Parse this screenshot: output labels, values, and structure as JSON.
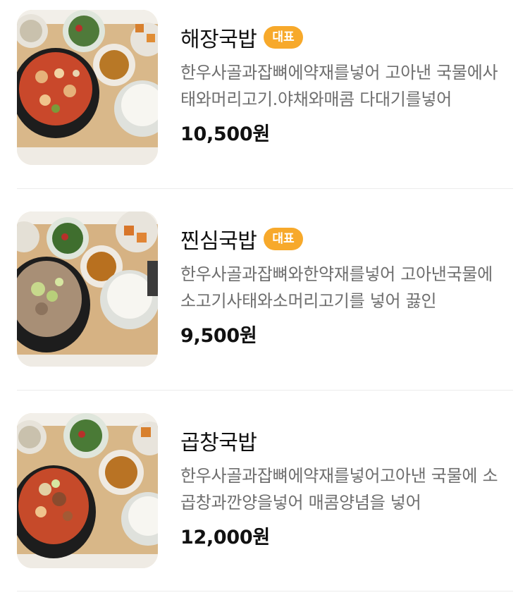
{
  "menu": {
    "items": [
      {
        "name": "해장국밥",
        "badge": "대표",
        "description": "한우사골과잡뼈에약재를넣어 고아낸 국물에사태와머리고기.야채와매콤 다대기를넣어",
        "price": "10,500원",
        "image": "haejang-gukbap-photo"
      },
      {
        "name": "찐심국밥",
        "badge": "대표",
        "description": "한우사골과잡뼈와한약재를넣어 고아낸국물에 소고기사태와소머리고기를 넣어 끓인",
        "price": "9,500원",
        "image": "jjinsim-gukbap-photo"
      },
      {
        "name": "곱창국밥",
        "badge": "",
        "description": "한우사골과잡뼈에약재를넣어고아낸 국물에 소곱창과깐양을넣어 매콤양념을 넣어",
        "price": "12,000원",
        "image": "gopchang-gukbap-photo"
      }
    ]
  },
  "colors": {
    "badge": "#f7a92b",
    "description": "#6e6e6e",
    "divider": "#ececec"
  }
}
